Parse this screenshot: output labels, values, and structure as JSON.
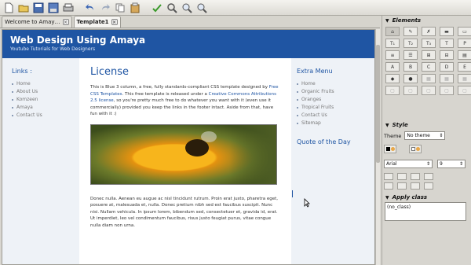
{
  "toolbar": {
    "buttons": [
      "new-document-icon",
      "open-folder-icon",
      "save-icon",
      "save-as-icon",
      "print-icon",
      "undo-icon",
      "redo-icon",
      "copy-icon",
      "paste-icon",
      "find-icon",
      "spellcheck-icon",
      "zoom-in-icon",
      "zoom-out-icon"
    ]
  },
  "tabs": [
    {
      "label": "Welcome to Amay…",
      "active": false
    },
    {
      "label": "Template1",
      "active": true
    }
  ],
  "site": {
    "title": "Web Design Using Amaya",
    "subtitle": "Youtube Tutorials for Web Designers"
  },
  "left_sidebar": {
    "heading": "Links :",
    "items": [
      "Home",
      "About Us",
      "Komzeen",
      "Amaya",
      "Contact Us"
    ]
  },
  "main": {
    "heading": "License",
    "para1_a": "This is Blue 3 column, a free, fully standards-compliant CSS template designed by ",
    "para1_link1": "Free CSS Templates",
    "para1_b": ". This free template is released under a ",
    "para1_link2": "Creative Commons Attributions 2.5 license",
    "para1_c": ", so you're pretty much free to do whatever you want with it (even use it commercially) provided you keep the links in the footer intact. Aside from that, have fun with it :)",
    "para2": "Donec nulla. Aenean eu augue ac nisl tincidunt rutrum. Proin erat justo, pharetra eget, posuere at, malesuada et, nulla. Donec pretium nibh sed est faucibus suscipit. Nunc nisi. Nullam vehicula. In ipsum lorem, bibendum sed, consectetuer et, gravida id, erat. Ut imperdiet, leo vel condimentum faucibus, risus justo feugiat purus, vitae congue nulla diam non urna."
  },
  "right_sidebar": {
    "heading": "Extra Menu",
    "items": [
      "Home",
      "Organic Fruits",
      "Oranges",
      "Tropical Fruits",
      "Contact Us",
      "Sitemap"
    ],
    "quote_heading": "Quote of the Day"
  },
  "panel": {
    "elements_title": "Elements",
    "element_buttons_row1": [
      "",
      "",
      "",
      "",
      ""
    ],
    "element_buttons_row2": [
      "T₁",
      "T₂",
      "T₃",
      "T",
      "P"
    ],
    "element_buttons_row3": [
      "≡",
      "☰",
      "⊞",
      "⊟",
      "▤"
    ],
    "element_buttons_row4": [
      "A",
      "B",
      "C",
      "D",
      "E"
    ],
    "element_buttons_row5": [
      "◆",
      "●",
      "▦",
      "▦",
      "▦"
    ],
    "element_buttons_row6": [
      "▢",
      "▢",
      "▢",
      "▢",
      "▢"
    ],
    "style_title": "Style",
    "theme_label": "Theme",
    "theme_value": "No theme",
    "font_value": "Arial",
    "size_value": "9",
    "apply_class_title": "Apply class",
    "class_value": "(no_class)"
  },
  "colors": {
    "header_blue": "#1f55a3",
    "sidebar_bg": "#eef2f7",
    "chrome": "#d7d5cf"
  }
}
